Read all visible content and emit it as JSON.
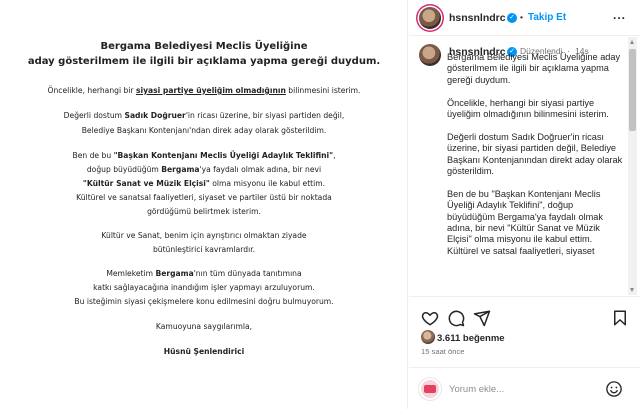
{
  "document": {
    "title_line1": "Bergama Belediyesi Meclis Üyeliğine",
    "title_line2": "aday gösterilmem ile ilgili bir açıklama yapma gereği duydum.",
    "p1_pre": "Öncelikle, herhangi bir ",
    "p1_em": "siyasi partiye üyeliğim olmadığının",
    "p1_post": " bilinmesini isterim.",
    "p2_l1_pre": "Değerli dostum ",
    "p2_l1_em": "Sadık Doğruer",
    "p2_l1_post": "'in ricası üzerine, bir siyasi partiden değil,",
    "p2_l2": "Belediye Başkanı Kontenjanı'ndan direk aday olarak gösterildim.",
    "p3_l1_pre": "Ben de bu ",
    "p3_l1_em": "\"Başkan Kontenjanı Meclis Üyeliği Adaylık Teklifini\"",
    "p3_l1_post": ",",
    "p3_l2_pre": "doğup büyüdüğüm ",
    "p3_l2_em": "Bergama",
    "p3_l2_post": "'ya faydalı olmak adına, bir nevi",
    "p3_l3_em": "\"Kültür Sanat ve Müzik Elçisi\"",
    "p3_l3_post": " olma misyonu ile kabul ettim.",
    "p3_l4": "Kültürel ve sanatsal faaliyetleri, siyaset ve partiler üstü bir noktada",
    "p3_l5": "gördüğümü belirtmek isterim.",
    "p4_l1": "Kültür ve Sanat, benim için ayrıştırıcı olmaktan ziyade",
    "p4_l2": "bütünleştirici kavramlardır.",
    "p5_l1_pre": "Memleketim ",
    "p5_l1_em": "Bergama",
    "p5_l1_post": "'nın tüm dünyada tanıtımına",
    "p5_l2": "katkı sağlayacağına inandığım işler yapmayı arzuluyorum.",
    "p5_l3": "Bu isteğimin siyasi çekişmelere konu edilmesini doğru bulmuyorum.",
    "p6": "Kamuoyuna saygılarımla,",
    "signature": "Hüsnü Şenlendirici"
  },
  "header": {
    "username": "hsnsnlndrc",
    "follow_label": "Takip Et",
    "more_label": "..."
  },
  "comment": {
    "username": "hsnsnlndrc",
    "edited_label": "Düzenlendi",
    "separator": "·",
    "age": "14s",
    "paragraphs": [
      "Bergama Belediyesi Meclis Üyeliğine aday gösterilmem ile ilgili bir açıklama yapma gereği duydum.",
      "Öncelikle, herhangi bir siyasi partiye üyeliğim olmadığının bilinmesini isterim.",
      "Değerli dostum Sadık Doğruer'in ricası üzerine, bir siyasi partiden değil, Belediye Başkanı Kontenjanından direkt aday olarak gösterildim.",
      "Ben de bu \"Başkan Kontenjanı Meclis Üyeliği Adaylık Teklifini\", doğup büyüdüğüm Bergama'ya faydalı olmak adına, bir nevi \"Kültür Sanat ve Müzik Elçisi\" olma misyonu ile kabul ettim. Kültürel ve satsal faaliyetleri, siyaset"
    ]
  },
  "actions": {
    "like_icon": "heart-icon",
    "comment_icon": "comment-icon",
    "share_icon": "share-icon",
    "save_icon": "bookmark-icon"
  },
  "stats": {
    "likes": "3.611 beğenme",
    "time": "15 saat önce"
  },
  "add_comment": {
    "placeholder": "Yorum ekle...",
    "emoji_icon": "emoji-icon"
  },
  "colors": {
    "accent": "#0095f6",
    "text": "#262626",
    "muted": "#737373"
  }
}
